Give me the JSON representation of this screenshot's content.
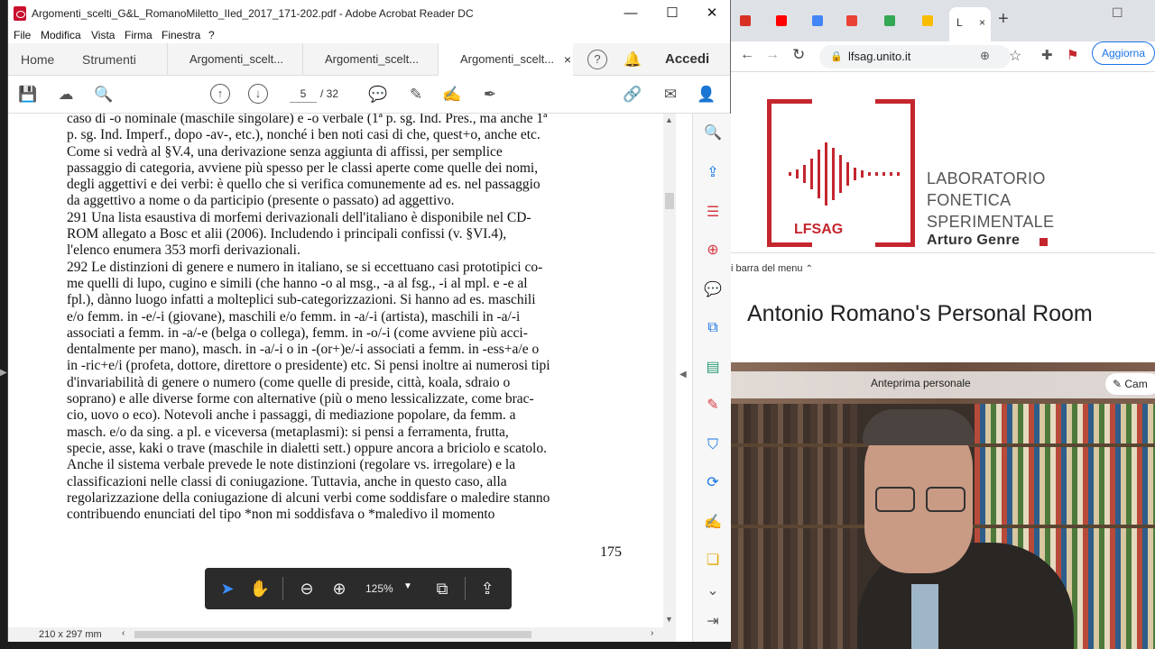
{
  "acrobat": {
    "title": "Argomenti_scelti_G&L_RomanoMiletto_IIed_2017_171-202.pdf - Adobe Acrobat Reader DC",
    "menu": [
      "File",
      "Modifica",
      "Vista",
      "Firma",
      "Finestra",
      "?"
    ],
    "nav_home": "Home",
    "nav_tools": "Strumenti",
    "tabs": [
      "Argomenti_scelt...",
      "Argomenti_scelt...",
      "Argomenti_scelt..."
    ],
    "tab_close": "×",
    "signin": "Accedi",
    "page_current": "5",
    "page_total": "/ 32",
    "page_number": "175",
    "zoom": "125%",
    "page_size": "210 x 297 mm"
  },
  "document": {
    "lines": [
      "caso di -o nominale (maschile singolare) e -o verbale (1ª p. sg. Ind. Pres., ma anche 1ª",
      "p. sg. Ind. Imperf., dopo -av-, etc.), nonché i ben noti casi di che, quest+o, anche etc.",
      "Come si vedrà al §V.4, una derivazione senza aggiunta di affissi, per semplice",
      "passaggio di categoria, avviene più spesso per le classi aperte come quelle dei nomi,",
      "degli aggettivi e dei verbi: è quello che si verifica comunemente ad es. nel passaggio",
      "da aggettivo a nome o da participio (presente o passato) ad aggettivo.",
      "291 Una lista esaustiva di morfemi derivazionali dell'italiano è disponibile nel CD-",
      "ROM allegato a Bosc et alii (2006). Includendo i principali confissi (v. §VI.4),",
      "l'elenco enumera 353 morfi derivazionali.",
      "292 Le distinzioni di genere e numero in italiano, se si eccettuano casi prototipici co-",
      "me quelli di lupo, cugino e simili (che hanno -o al msg., -a al fsg., -i al mpl. e -e al",
      "fpl.), dànno luogo infatti a molteplici sub-categorizzazioni. Si hanno ad es. maschili",
      "e/o femm. in -e/-i (giovane), maschili e/o femm. in -a/-i (artista), maschili in -a/-i",
      "associati a femm. in -a/-e (belga o collega), femm. in -o/-i (come avviene più acci-",
      "dentalmente per mano), masch. in -a/-i o in -(or+)e/-i associati a femm. in -ess+a/e o",
      "in -ric+e/i (profeta, dottore, direttore o presidente) etc. Si pensi inoltre ai numerosi tipi",
      "d'invariabilità di genere o numero (come quelle di preside, città, koala, sdraio o",
      "soprano) e alle diverse forme con alternative (più o meno lessicalizzate, come brac-",
      "cio, uovo o eco). Notevoli anche i passaggi, di mediazione popolare, da femm. a",
      "masch. e/o da sing. a pl. e viceversa (metaplasmi): si pensi a ferramenta, frutta,",
      "specie, asse, kaki o trave (maschile in dialetti sett.) oppure ancora a briciolo e scatolo.",
      "Anche il sistema verbale prevede le note distinzioni (regolare vs. irregolare) e la",
      "classificazioni nelle classi di coniugazione. Tuttavia, anche in questo caso, alla",
      "regolarizzazione della coniugazione di alcuni verbi come soddisfare o maledire stanno",
      "contribuendo enunciati del tipo *non mi soddisfava o *maledivo il momento"
    ]
  },
  "browser": {
    "tab_active_label": "L",
    "tab_close": "×",
    "new_tab": "+",
    "url": "lfsag.unito.it",
    "update_button": "Aggiorna",
    "lab_logo": "LFSAG",
    "lab_name_1": "LABORATORIO",
    "lab_name_2": "FONETICA",
    "lab_name_3": "SPERIMENTALE",
    "lab_name_4": "Arturo Genre",
    "hide_bar": "i barra del menu",
    "room_title": "Antonio Romano's Personal Room",
    "preview_label": "Anteprima personale",
    "camera_button": "Cam"
  },
  "colors": {
    "brand_red": "#c4262e",
    "acrobat_accent": "#1473e6",
    "toolbar_dark": "#2b2b2b"
  }
}
